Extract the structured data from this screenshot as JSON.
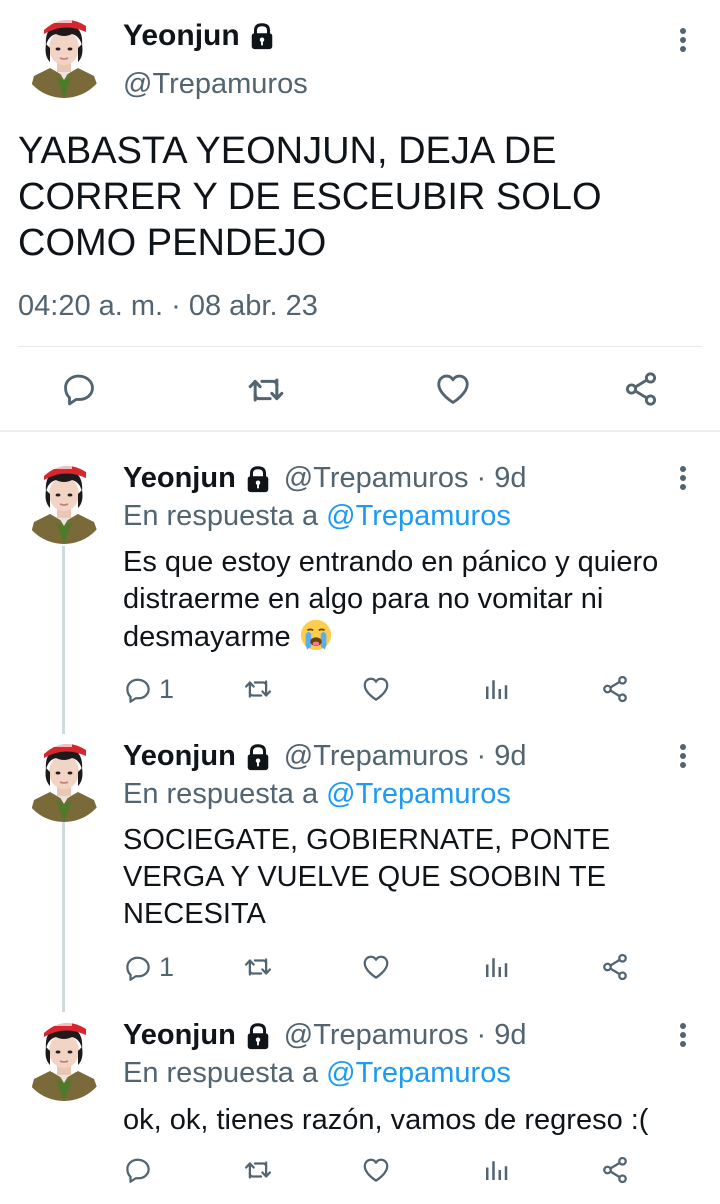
{
  "main_tweet": {
    "display_name": "Yeonjun",
    "handle": "@Trepamuros",
    "text": "YABASTA YEONJUN, DEJA DE CORRER Y DE ESCEUBIR SOLO COMO PENDEJO",
    "timestamp": "04:20 a. m. · 08 abr. 23",
    "actions": [
      "reply-icon",
      "retweet-icon",
      "like-icon",
      "share-icon"
    ]
  },
  "replies": [
    {
      "display_name": "Yeonjun",
      "handle_time": "@Trepamuros · 9d",
      "reply_prefix": "En respuesta a",
      "reply_to": "@Trepamuros",
      "text": "Es que estoy entrando en pánico y quiero distraerme en algo para no vomitar ni desmayarme",
      "emoji": "loudly-crying-face",
      "reply_count": "1"
    },
    {
      "display_name": "Yeonjun",
      "handle_time": "@Trepamuros · 9d",
      "reply_prefix": "En respuesta a",
      "reply_to": "@Trepamuros",
      "text": "SOCIEGATE, GOBIERNATE, PONTE VERGA Y VUELVE QUE SOOBIN TE NECESITA",
      "reply_count": "1"
    },
    {
      "display_name": "Yeonjun",
      "handle_time": "@Trepamuros · 9d",
      "reply_prefix": "En respuesta a",
      "reply_to": "@Trepamuros",
      "text": "ok, ok, tienes razón, vamos de regreso :(",
      "reply_count": ""
    }
  ],
  "colors": {
    "text_primary": "#0f1419",
    "text_secondary": "#536471",
    "link": "#1d9bf0",
    "divider": "#e6e9ea",
    "thread_line": "#cfd9de"
  }
}
